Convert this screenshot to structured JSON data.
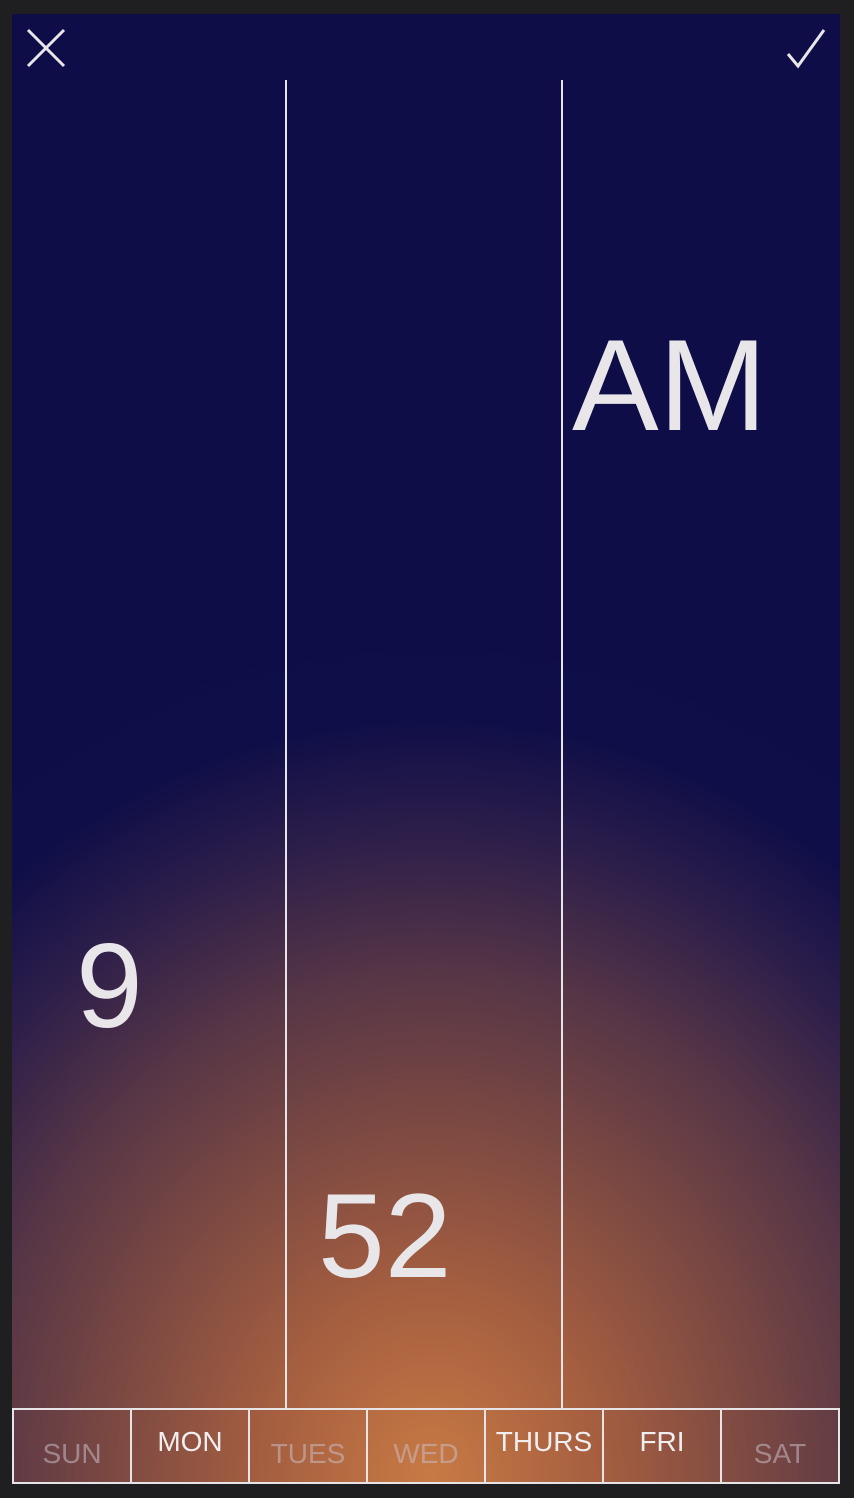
{
  "toolbar": {
    "close_icon": "close-icon",
    "confirm_icon": "checkmark-icon"
  },
  "time": {
    "hour": "9",
    "minute": "52",
    "meridiem": "AM"
  },
  "days": [
    {
      "label": "SUN",
      "selected": false
    },
    {
      "label": "MON",
      "selected": true
    },
    {
      "label": "TUES",
      "selected": false
    },
    {
      "label": "WED",
      "selected": false
    },
    {
      "label": "THURS",
      "selected": true
    },
    {
      "label": "FRI",
      "selected": true
    },
    {
      "label": "SAT",
      "selected": false
    }
  ],
  "colors": {
    "background_top": "#0e0d47",
    "background_glow": "#c87a44",
    "foreground": "#e8e6e9"
  }
}
